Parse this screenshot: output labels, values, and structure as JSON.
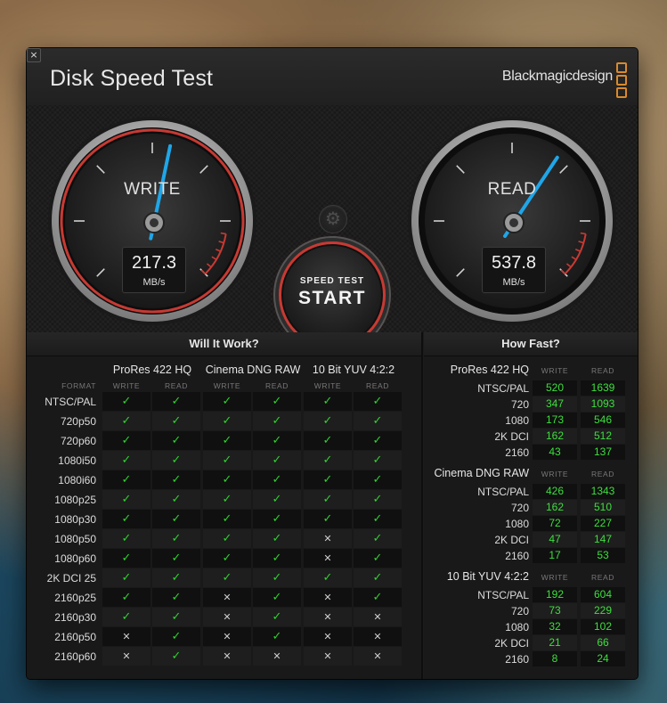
{
  "app": {
    "title": "Disk Speed Test",
    "brand": "Blackmagicdesign",
    "close_glyph": "×"
  },
  "gauges": {
    "write": {
      "label": "WRITE",
      "value": "217.3",
      "unit": "MB/s",
      "level_mb_s": 217.3
    },
    "read": {
      "label": "READ",
      "value": "537.8",
      "unit": "MB/s",
      "level_mb_s": 537.8
    }
  },
  "start_button": {
    "small": "SPEED TEST",
    "big": "START"
  },
  "settings_icon": "gear-icon",
  "colors": {
    "pass": "#2fd12f",
    "fail": "#cfcfcf",
    "accent_red": "#c73a33",
    "needle": "#1fa6e8",
    "fast_value": "#3ddf3d"
  },
  "will_it_work": {
    "title": "Will It Work?",
    "format_header": "FORMAT",
    "codecs": [
      {
        "name": "ProRes 422 HQ",
        "write": "WRITE",
        "read": "READ"
      },
      {
        "name": "Cinema DNG RAW",
        "write": "WRITE",
        "read": "READ"
      },
      {
        "name": "10 Bit YUV 4:2:2",
        "write": "WRITE",
        "read": "READ"
      }
    ],
    "rows": [
      {
        "format": "NTSC/PAL",
        "cells": [
          1,
          1,
          1,
          1,
          1,
          1
        ]
      },
      {
        "format": "720p50",
        "cells": [
          1,
          1,
          1,
          1,
          1,
          1
        ]
      },
      {
        "format": "720p60",
        "cells": [
          1,
          1,
          1,
          1,
          1,
          1
        ]
      },
      {
        "format": "1080i50",
        "cells": [
          1,
          1,
          1,
          1,
          1,
          1
        ]
      },
      {
        "format": "1080i60",
        "cells": [
          1,
          1,
          1,
          1,
          1,
          1
        ]
      },
      {
        "format": "1080p25",
        "cells": [
          1,
          1,
          1,
          1,
          1,
          1
        ]
      },
      {
        "format": "1080p30",
        "cells": [
          1,
          1,
          1,
          1,
          1,
          1
        ]
      },
      {
        "format": "1080p50",
        "cells": [
          1,
          1,
          1,
          1,
          0,
          1
        ]
      },
      {
        "format": "1080p60",
        "cells": [
          1,
          1,
          1,
          1,
          0,
          1
        ]
      },
      {
        "format": "2K DCI 25",
        "cells": [
          1,
          1,
          1,
          1,
          1,
          1
        ]
      },
      {
        "format": "2160p25",
        "cells": [
          1,
          1,
          0,
          1,
          0,
          1
        ]
      },
      {
        "format": "2160p30",
        "cells": [
          1,
          1,
          0,
          1,
          0,
          0
        ]
      },
      {
        "format": "2160p50",
        "cells": [
          0,
          1,
          0,
          1,
          0,
          0
        ]
      },
      {
        "format": "2160p60",
        "cells": [
          0,
          1,
          0,
          0,
          0,
          0
        ]
      }
    ],
    "pass_glyph": "✓",
    "fail_glyph": "✕"
  },
  "how_fast": {
    "title": "How Fast?",
    "groups": [
      {
        "name": "ProRes 422 HQ",
        "write_header": "WRITE",
        "read_header": "READ",
        "rows": [
          {
            "label": "NTSC/PAL",
            "write": "520",
            "read": "1639"
          },
          {
            "label": "720",
            "write": "347",
            "read": "1093"
          },
          {
            "label": "1080",
            "write": "173",
            "read": "546"
          },
          {
            "label": "2K DCI",
            "write": "162",
            "read": "512"
          },
          {
            "label": "2160",
            "write": "43",
            "read": "137"
          }
        ]
      },
      {
        "name": "Cinema DNG RAW",
        "write_header": "WRITE",
        "read_header": "READ",
        "rows": [
          {
            "label": "NTSC/PAL",
            "write": "426",
            "read": "1343"
          },
          {
            "label": "720",
            "write": "162",
            "read": "510"
          },
          {
            "label": "1080",
            "write": "72",
            "read": "227"
          },
          {
            "label": "2K DCI",
            "write": "47",
            "read": "147"
          },
          {
            "label": "2160",
            "write": "17",
            "read": "53"
          }
        ]
      },
      {
        "name": "10 Bit YUV 4:2:2",
        "write_header": "WRITE",
        "read_header": "READ",
        "rows": [
          {
            "label": "NTSC/PAL",
            "write": "192",
            "read": "604"
          },
          {
            "label": "720",
            "write": "73",
            "read": "229"
          },
          {
            "label": "1080",
            "write": "32",
            "read": "102"
          },
          {
            "label": "2K DCI",
            "write": "21",
            "read": "66"
          },
          {
            "label": "2160",
            "write": "8",
            "read": "24"
          }
        ]
      }
    ]
  }
}
